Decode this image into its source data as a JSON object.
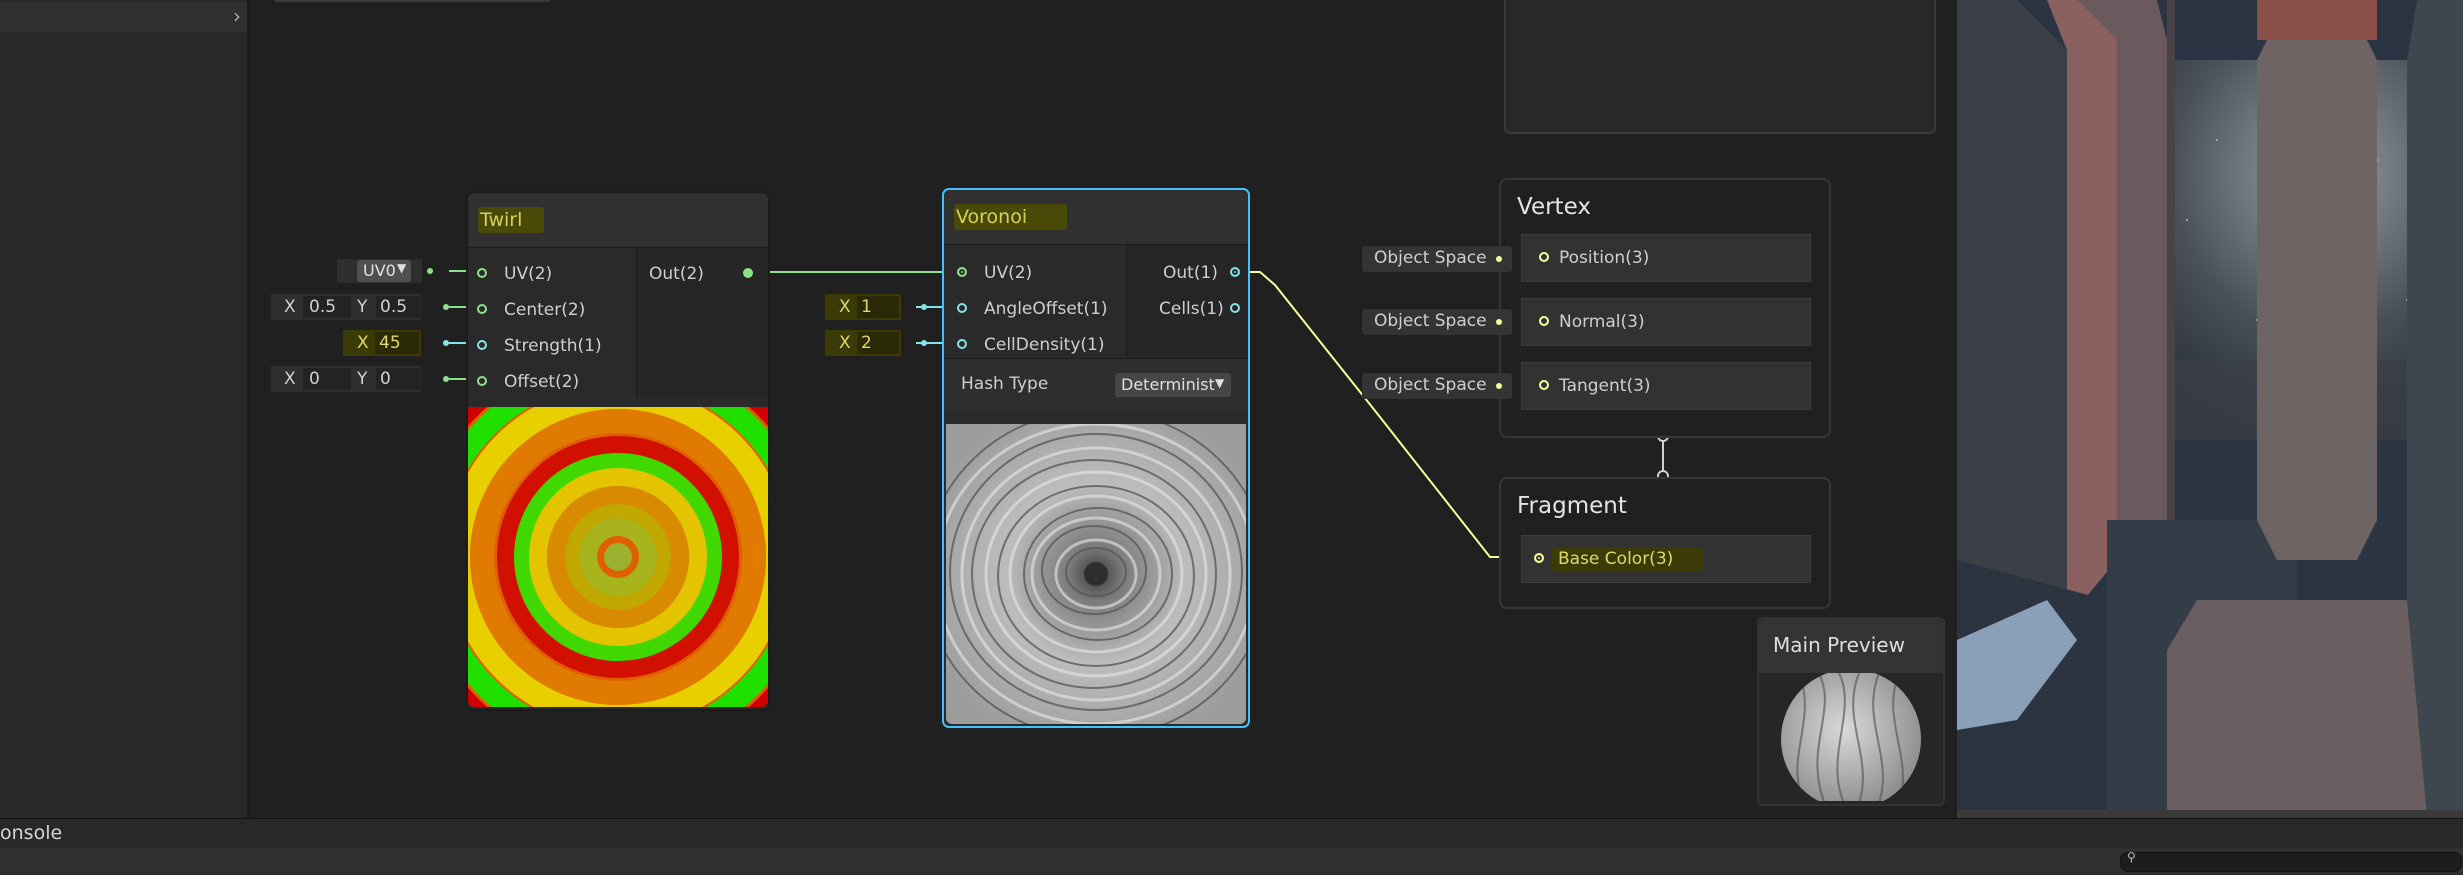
{
  "bottom": {
    "console_label": "onsole"
  },
  "twirl": {
    "title": "Twirl",
    "inputs": [
      "UV(2)",
      "Center(2)",
      "Strength(1)",
      "Offset(2)"
    ],
    "output": "Out(2)",
    "uv_dropdown": "UV0",
    "center": {
      "x_label": "X",
      "x": "0.5",
      "y_label": "Y",
      "y": "0.5"
    },
    "strength": {
      "x_label": "X",
      "x": "45"
    },
    "offset": {
      "x_label": "X",
      "x": "0",
      "y_label": "Y",
      "y": "0"
    }
  },
  "voronoi": {
    "title": "Voronoi",
    "inputs": [
      "UV(2)",
      "AngleOffset(1)",
      "CellDensity(1)"
    ],
    "outputs": [
      "Out(1)",
      "Cells(1)"
    ],
    "angle_offset": {
      "x_label": "X",
      "x": "1"
    },
    "cell_density": {
      "x_label": "X",
      "x": "2"
    },
    "hash_type_label": "Hash Type",
    "hash_type_value": "Determinist"
  },
  "vertex": {
    "title": "Vertex",
    "slots": [
      "Position(3)",
      "Normal(3)",
      "Tangent(3)"
    ],
    "space_labels": [
      "Object Space",
      "Object Space",
      "Object Space"
    ]
  },
  "fragment": {
    "title": "Fragment",
    "slots": [
      "Base Color(3)"
    ]
  },
  "main_preview": {
    "title": "Main Preview"
  },
  "colors": {
    "vector2_port": "#8be386",
    "vector1_port": "#84e4e7",
    "vector3_port": "#f6ff9a",
    "selection": "#44c0ff",
    "title_text": "#d8d05a"
  }
}
